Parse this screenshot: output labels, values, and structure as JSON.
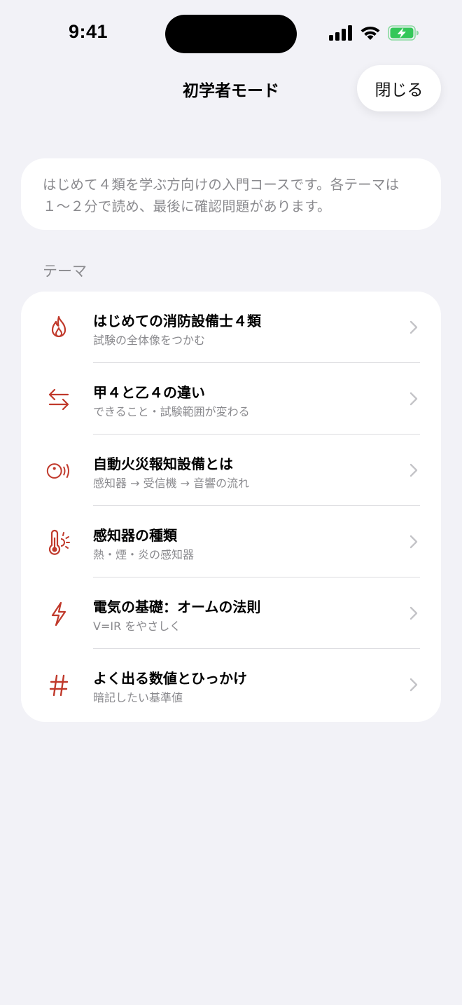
{
  "status_bar": {
    "time": "9:41",
    "icons": [
      "cellular-signal-icon",
      "wifi-icon",
      "battery-charging-icon"
    ],
    "battery_color": "#34c759"
  },
  "header": {
    "title": "初学者モード",
    "close_label": "閉じる"
  },
  "intro": {
    "text": "はじめて４類を学ぶ方向けの入門コースです。各テーマは１〜２分で読め、最後に確認問題があります。"
  },
  "section": {
    "title": "テーマ"
  },
  "accent_color": "#c0392b",
  "topics": [
    {
      "icon": "flame-icon",
      "title": "はじめての消防設備士４類",
      "subtitle": "試験の全体像をつかむ"
    },
    {
      "icon": "arrows-swap-icon",
      "title": "甲４と乙４の違い",
      "subtitle": "できること・試験範囲が変わる"
    },
    {
      "icon": "sensor-wave-icon",
      "title": "自動火災報知設備とは",
      "subtitle": "感知器 → 受信機 → 音響の流れ"
    },
    {
      "icon": "thermometer-sun-icon",
      "title": "感知器の種類",
      "subtitle": "熱・煙・炎の感知器"
    },
    {
      "icon": "bolt-icon",
      "title": "電気の基礎：オームの法則",
      "subtitle": "V=IR をやさしく"
    },
    {
      "icon": "number-sign-icon",
      "title": "よく出る数値とひっかけ",
      "subtitle": "暗記したい基準値"
    }
  ]
}
